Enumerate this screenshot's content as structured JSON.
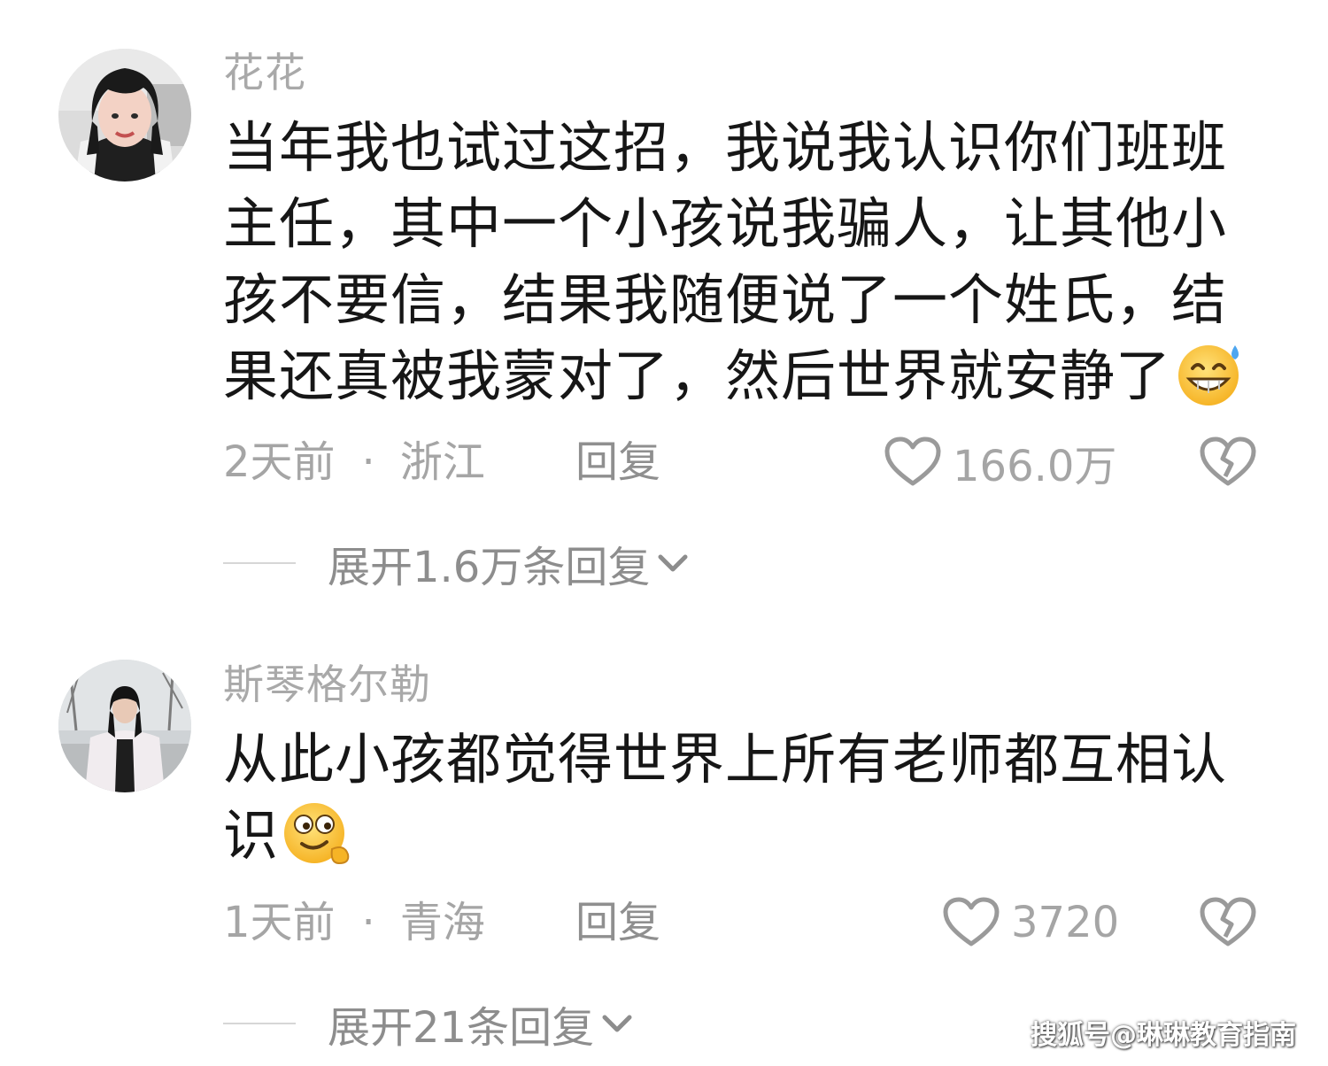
{
  "comments": [
    {
      "username": "花花",
      "text": "当年我也试过这招，我说我认识你们班班主任，其中一个小孩说我骗人，让其他小孩不要信，结果我随便说了一个姓氏，结果还真被我蒙对了，然后世界就安静了",
      "emoji": "sweat-smile-emoji",
      "time": "2天前",
      "location": "浙江",
      "reply_label": "回复",
      "likes": "166.0万",
      "expand_label": "展开1.6万条回复"
    },
    {
      "username": "斯琴格尔勒",
      "text": "从此小孩都觉得世界上所有老师都互相认识",
      "emoji": "thinking-smile-emoji",
      "time": "1天前",
      "location": "青海",
      "reply_label": "回复",
      "likes": "3720",
      "expand_label": "展开21条回复"
    }
  ],
  "separator": "·",
  "watermark": "搜狐号@琳琳教育指南",
  "colors": {
    "username": "#a9a9a9",
    "body_text": "#161616",
    "meta_text": "#a5a5a5",
    "reply_text": "#8f8f8f"
  }
}
